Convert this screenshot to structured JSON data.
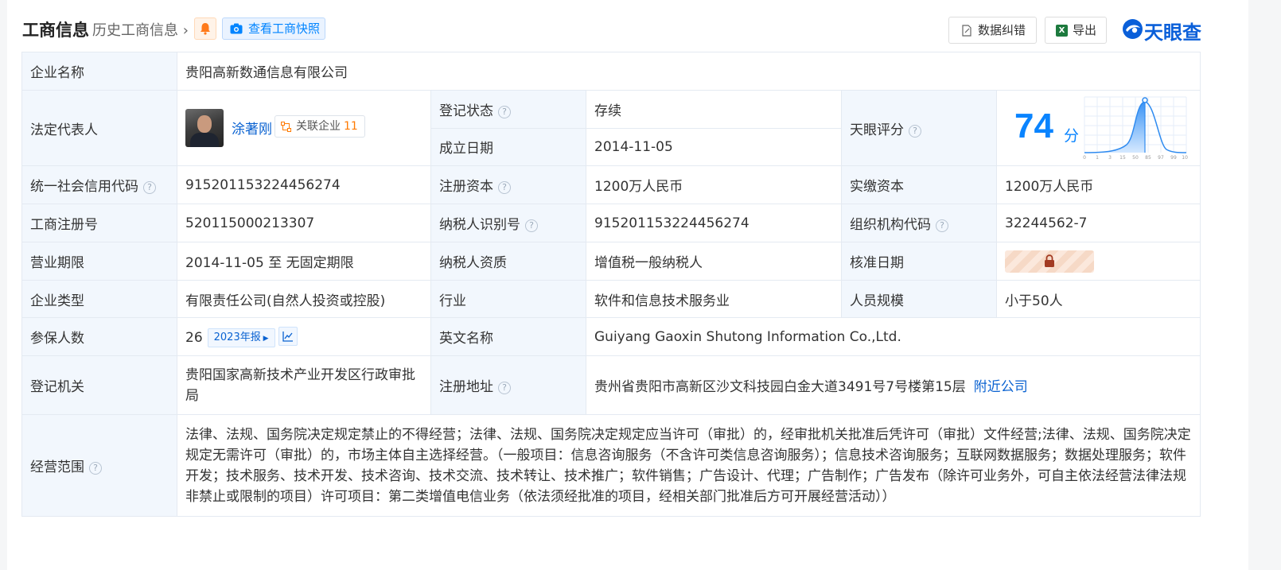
{
  "header": {
    "title": "工商信息",
    "history_link": "历史工商信息",
    "snapshot_button": "查看工商快照",
    "data_error_button": "数据纠错",
    "export_button": "导出",
    "logo_text": "天眼查"
  },
  "colors": {
    "accent": "#0a84ff",
    "status_green": "#2fa84f",
    "label_bg": "#f2f7fd",
    "logo": "#0a5fd9"
  },
  "company": {
    "name_label": "企业名称",
    "name": "贵阳高新数通信息有限公司",
    "legal_rep_label": "法定代表人",
    "legal_rep": "涂著刚",
    "related_label": "关联企业",
    "related_count": "11",
    "reg_status_label": "登记状态",
    "reg_status": "存续",
    "est_date_label": "成立日期",
    "est_date": "2014-11-05",
    "score_label": "天眼评分",
    "score": "74",
    "score_unit": "分",
    "score_ticks": [
      "0",
      "1",
      "3",
      "15",
      "50",
      "85",
      "97",
      "99",
      "100"
    ],
    "credit_code_label": "统一社会信用代码",
    "credit_code": "915201153224456274",
    "reg_capital_label": "注册资本",
    "reg_capital": "1200万人民币",
    "paid_capital_label": "实缴资本",
    "paid_capital": "1200万人民币",
    "biz_reg_no_label": "工商注册号",
    "biz_reg_no": "520115000213307",
    "taxpayer_id_label": "纳税人识别号",
    "taxpayer_id": "915201153224456274",
    "org_code_label": "组织机构代码",
    "org_code": "32244562-7",
    "term_label": "营业期限",
    "term": "2014-11-05 至 无固定期限",
    "taxpayer_qual_label": "纳税人资质",
    "taxpayer_qual": "增值税一般纳税人",
    "approval_date_label": "核准日期",
    "type_label": "企业类型",
    "type": "有限责任公司(自然人投资或控股)",
    "industry_label": "行业",
    "industry": "软件和信息技术服务业",
    "staff_size_label": "人员规模",
    "staff_size": "小于50人",
    "insured_label": "参保人数",
    "insured": "26",
    "insured_year": "2023年报",
    "english_name_label": "英文名称",
    "english_name": "Guiyang Gaoxin Shutong Information Co.,Ltd.",
    "reg_authority_label": "登记机关",
    "reg_authority": "贵阳国家高新技术产业开发区行政审批局",
    "reg_address_label": "注册地址",
    "reg_address": "贵州省贵阳市高新区沙文科技园白金大道3491号7号楼第15层",
    "nearby_link": "附近公司",
    "scope_label": "经营范围",
    "scope": "法律、法规、国务院决定规定禁止的不得经营；法律、法规、国务院决定规定应当许可（审批）的，经审批机关批准后凭许可（审批）文件经营;法律、法规、国务院决定规定无需许可（审批）的，市场主体自主选择经营。（一般项目：信息咨询服务（不含许可类信息咨询服务）；信息技术咨询服务；互联网数据服务；数据处理服务；软件开发；技术服务、技术开发、技术咨询、技术交流、技术转让、技术推广；软件销售；广告设计、代理；广告制作；广告发布（除许可业务外，可自主依法经营法律法规非禁止或限制的项目）许可项目：第二类增值电信业务（依法须经批准的项目，经相关部门批准后方可开展经营活动））"
  }
}
